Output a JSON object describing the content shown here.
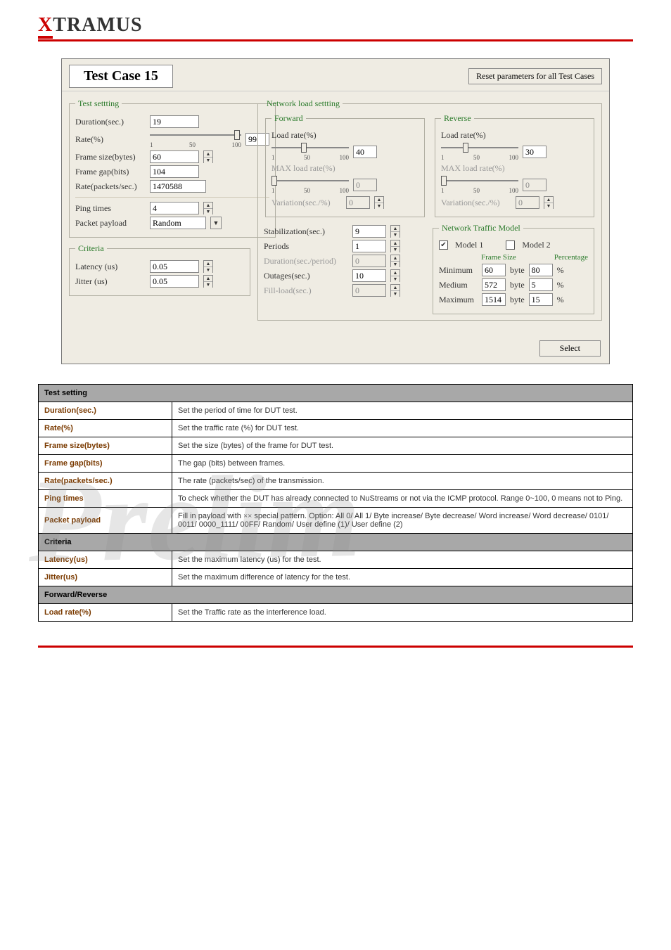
{
  "brand": "XTRAMUS",
  "watermark": "Prelim",
  "panel": {
    "title": "Test Case 15",
    "reset_btn": "Reset parameters for all Test Cases",
    "select_btn": "Select"
  },
  "test_setting": {
    "legend": "Test settting",
    "duration_label": "Duration(sec.)",
    "duration_value": "19",
    "rate_label": "Rate(%)",
    "rate_value": "99",
    "rate_ticks": {
      "a": "1",
      "b": "50",
      "c": "100"
    },
    "frame_size_label": "Frame size(bytes)",
    "frame_size_value": "60",
    "frame_gap_label": "Frame gap(bits)",
    "frame_gap_value": "104",
    "rate_pps_label": "Rate(packets/sec.)",
    "rate_pps_value": "1470588",
    "ping_label": "Ping times",
    "ping_value": "4",
    "payload_label": "Packet payload",
    "payload_value": "Random"
  },
  "criteria": {
    "legend": "Criteria",
    "latency_label": "Latency (us)",
    "latency_value": "0.05",
    "jitter_label": "Jitter (us)",
    "jitter_value": "0.05"
  },
  "network": {
    "legend": "Network load settting",
    "forward": {
      "legend": "Forward",
      "load_label": "Load rate(%)",
      "load_value": "40",
      "ticks": {
        "a": "1",
        "b": "50",
        "c": "100"
      },
      "max_label": "MAX load rate(%)",
      "max_value": "0",
      "var_label": "Variation(sec./%)",
      "var_value": "0"
    },
    "reverse": {
      "legend": "Reverse",
      "load_label": "Load rate(%)",
      "load_value": "30",
      "ticks": {
        "a": "1",
        "b": "50",
        "c": "100"
      },
      "max_label": "MAX load rate(%)",
      "max_value": "0",
      "var_label": "Variation(sec./%)",
      "var_value": "0"
    },
    "timing": {
      "stab_label": "Stabilization(sec.)",
      "stab_value": "9",
      "periods_label": "Periods",
      "periods_value": "1",
      "dpp_label": "Duration(sec./period)",
      "dpp_value": "0",
      "out_label": "Outages(sec.)",
      "out_value": "10",
      "fill_label": "Fill-load(sec.)",
      "fill_value": "0"
    },
    "ntm": {
      "legend": "Network Traffic Model",
      "model1": "Model 1",
      "model2": "Model 2",
      "fs_head": "Frame Size",
      "pc_head": "Percentage",
      "byte": "byte",
      "pct": "%",
      "min_label": "Minimum",
      "min_fs": "60",
      "min_pc": "80",
      "med_label": "Medium",
      "med_fs": "572",
      "med_pc": "5",
      "max_label": "Maximum",
      "max_fs": "1514",
      "max_pc": "15"
    }
  },
  "table": {
    "hdr_test": "Test setting",
    "rows_test": [
      {
        "name": "Duration(sec.)",
        "desc": "Set the period of time for DUT test."
      },
      {
        "name": "Rate(%)",
        "desc": "Set the traffic rate (%) for DUT test."
      },
      {
        "name": "Frame size(bytes)",
        "desc": "Set the size (bytes) of the frame for DUT test."
      },
      {
        "name": "Frame gap(bits)",
        "desc": "The gap (bits) between frames."
      },
      {
        "name": "Rate(packets/sec.)",
        "desc": "The rate (packets/sec) of the transmission."
      },
      {
        "name": "Ping times",
        "desc": "To check whether the DUT has already connected to NuStreams or not via the ICMP protocol. Range 0~100, 0 means not to Ping."
      },
      {
        "name": "Packet payload",
        "desc_prefix": "Fill in payload with ",
        "desc_suffix": " special pattern. Option: All 0/ All 1/ Byte increase/ Byte decrease/ Word increase/ Word decrease/ 0101/ 0011/ 0000_1111/ 00FF/ Random/ User define (1)/ User define (2)"
      }
    ],
    "hdr_criteria": "Criteria",
    "rows_criteria": [
      {
        "name": "Latency(us)",
        "desc": "Set the maximum latency (us) for the test."
      },
      {
        "name": "Jitter(us)",
        "desc": "Set the maximum difference of latency for the test."
      }
    ],
    "hdr_forward": "Forward/Reverse",
    "rows_forward": [
      {
        "name": "Load rate(%)",
        "desc": "Set the Traffic rate as the interference load."
      }
    ]
  },
  "x_glyph": "×"
}
